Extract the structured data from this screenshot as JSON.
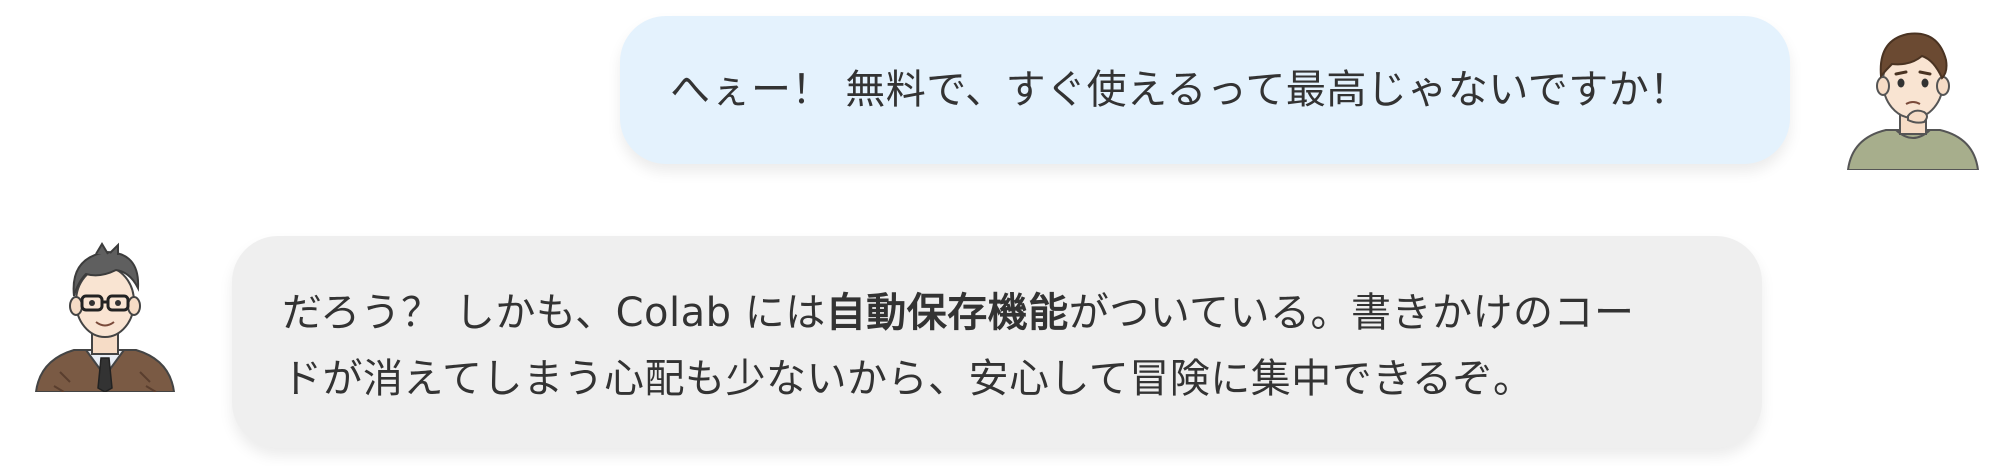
{
  "messages": [
    {
      "side": "right",
      "speaker_icon": "young-man-avatar-icon",
      "text": "へぇー！ 無料で、すぐ使えるって最高じゃないですか！",
      "bubble_color": "#e4f2fd"
    },
    {
      "side": "left",
      "speaker_icon": "glasses-man-avatar-icon",
      "text_before": "だろう？ しかも、Colab には",
      "text_bold": "自動保存機能",
      "text_after": "がついている。書きかけのコー",
      "text_line2": "ドが消えてしまう心配も少ないから、安心して冒険に集中できるぞ。",
      "bubble_color": "#efefef"
    }
  ]
}
